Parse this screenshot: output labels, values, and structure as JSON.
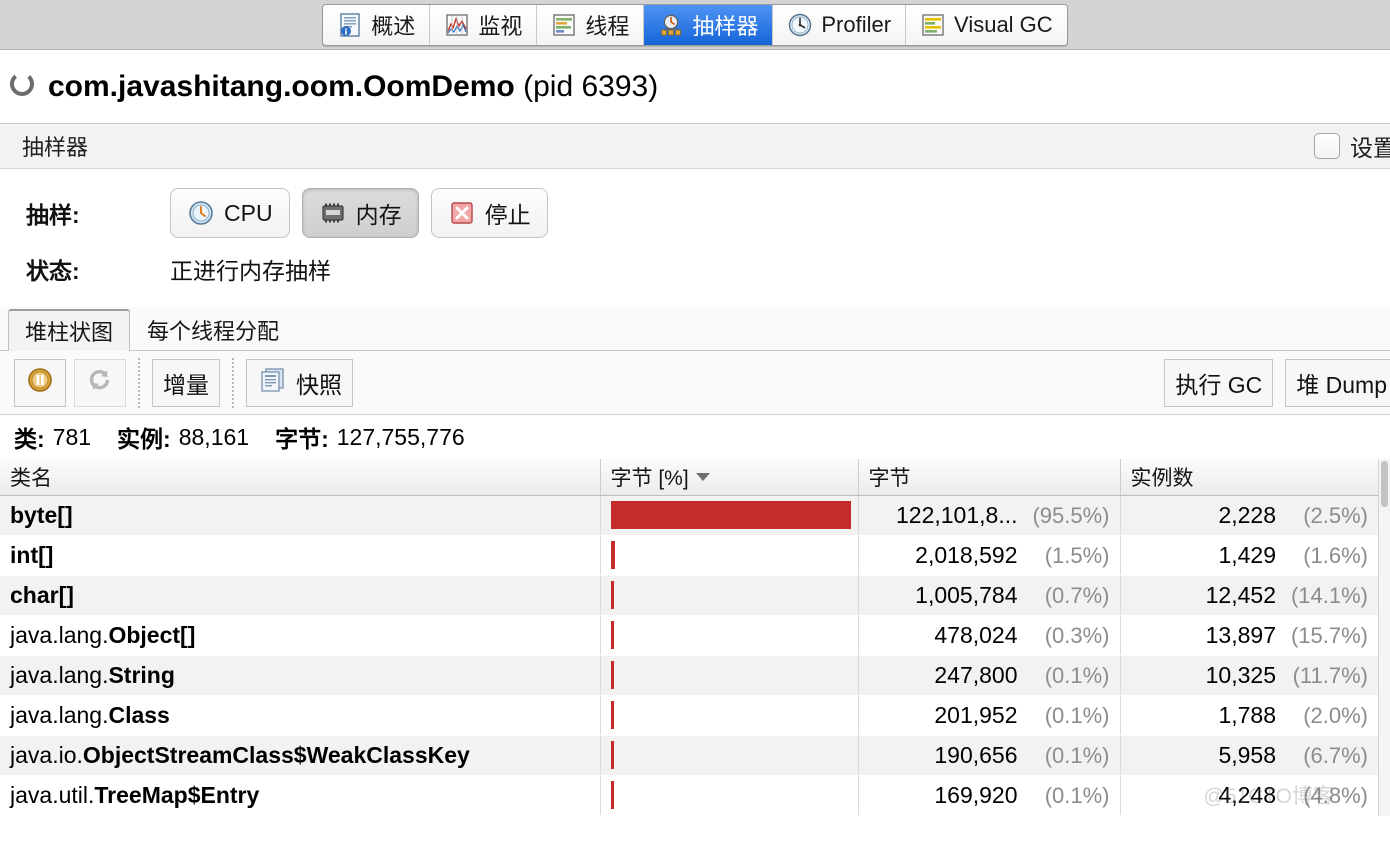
{
  "tabbar": {
    "tabs": [
      {
        "label": "概述",
        "icon": "overview-icon",
        "selected": false
      },
      {
        "label": "监视",
        "icon": "monitor-icon",
        "selected": false
      },
      {
        "label": "线程",
        "icon": "threads-icon",
        "selected": false
      },
      {
        "label": "抽样器",
        "icon": "sampler-icon",
        "selected": true
      },
      {
        "label": "Profiler",
        "icon": "profiler-icon",
        "selected": false
      },
      {
        "label": "Visual GC",
        "icon": "visualgc-icon",
        "selected": false
      }
    ]
  },
  "app": {
    "name": "com.javashitang.oom.OomDemo",
    "pid_text": "(pid 6393)"
  },
  "panel": {
    "title": "抽样器",
    "settings_label": "设置",
    "settings_checked": false
  },
  "sampling": {
    "row_label": "抽样:",
    "cpu_label": "CPU",
    "memory_label": "内存",
    "stop_label": "停止",
    "memory_pressed": true,
    "status_label": "状态:",
    "status_value": "正进行内存抽样"
  },
  "subtabs": [
    {
      "label": "堆柱状图",
      "active": true
    },
    {
      "label": "每个线程分配",
      "active": false
    }
  ],
  "toolbar": {
    "pause_icon": "pause-icon",
    "refresh_icon": "refresh-icon",
    "delta_label": "增量",
    "snapshot_label": "快照",
    "snapshot_icon": "snapshot-icon",
    "gc_label": "执行 GC",
    "heapdump_label": "堆 Dump"
  },
  "summary": {
    "classes_key": "类:",
    "classes_value": "781",
    "instances_key": "实例:",
    "instances_value": "88,161",
    "bytes_key": "字节:",
    "bytes_value": "127,755,776"
  },
  "colors": {
    "bar": "#c62b2b",
    "tab_selected_top": "#4f93f4",
    "tab_selected_bottom": "#1565d8",
    "percent_text": "#8c8c8c"
  },
  "table": {
    "columns": [
      {
        "label": "类名",
        "sorted": false
      },
      {
        "label": "字节 [%]",
        "sorted": true,
        "direction": "desc"
      },
      {
        "label": "字节",
        "sorted": false
      },
      {
        "label": "实例数",
        "sorted": false
      }
    ],
    "rows": [
      {
        "pkg": "",
        "cls": "byte[]",
        "bar_pct": 95.5,
        "bytes": "122,101,8...",
        "bytes_pct": "(95.5%)",
        "instances": "2,228",
        "inst_pct": "(2.5%)"
      },
      {
        "pkg": "",
        "cls": "int[]",
        "bar_pct": 1.5,
        "bytes": "2,018,592",
        "bytes_pct": "(1.5%)",
        "instances": "1,429",
        "inst_pct": "(1.6%)"
      },
      {
        "pkg": "",
        "cls": "char[]",
        "bar_pct": 0.7,
        "bytes": "1,005,784",
        "bytes_pct": "(0.7%)",
        "instances": "12,452",
        "inst_pct": "(14.1%)"
      },
      {
        "pkg": "java.lang.",
        "cls": "Object[]",
        "bar_pct": 0.3,
        "bytes": "478,024",
        "bytes_pct": "(0.3%)",
        "instances": "13,897",
        "inst_pct": "(15.7%)"
      },
      {
        "pkg": "java.lang.",
        "cls": "String",
        "bar_pct": 0.1,
        "bytes": "247,800",
        "bytes_pct": "(0.1%)",
        "instances": "10,325",
        "inst_pct": "(11.7%)"
      },
      {
        "pkg": "java.lang.",
        "cls": "Class",
        "bar_pct": 0.1,
        "bytes": "201,952",
        "bytes_pct": "(0.1%)",
        "instances": "1,788",
        "inst_pct": "(2.0%)"
      },
      {
        "pkg": "java.io.",
        "cls": "ObjectStreamClass$WeakClassKey",
        "bar_pct": 0.1,
        "bytes": "190,656",
        "bytes_pct": "(0.1%)",
        "instances": "5,958",
        "inst_pct": "(6.7%)"
      },
      {
        "pkg": "java.util.",
        "cls": "TreeMap$Entry",
        "bar_pct": 0.1,
        "bytes": "169,920",
        "bytes_pct": "(0.1%)",
        "instances": "4,248",
        "inst_pct": "(4.8%)"
      }
    ]
  },
  "watermark": {
    "text": "@51CTO博客"
  }
}
